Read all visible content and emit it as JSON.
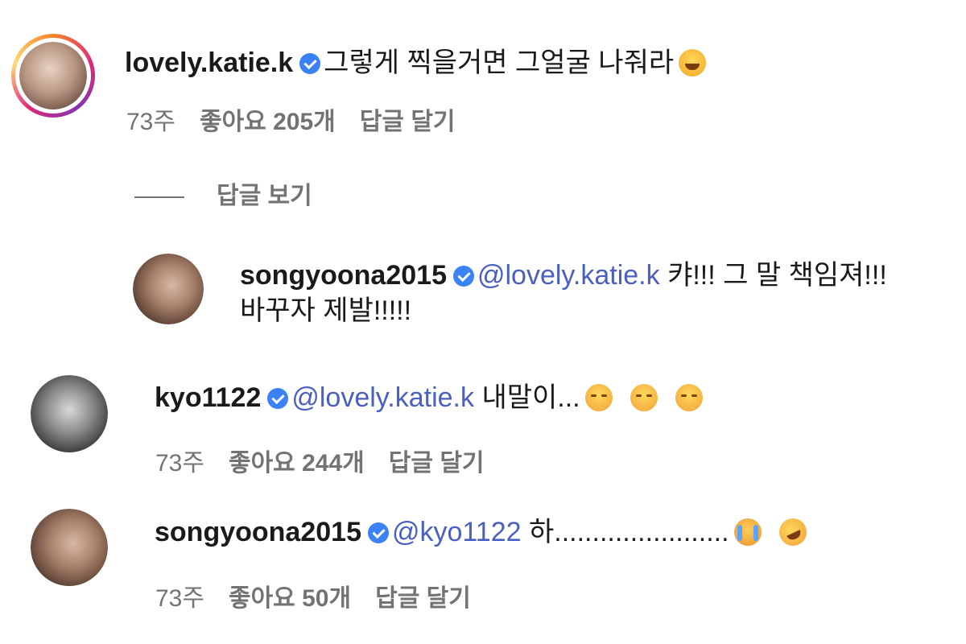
{
  "comments": [
    {
      "username": "lovely.katie.k",
      "text": "그렇게 찍을거면 그얼굴 나줘라",
      "emoji": "laughing-with-tears",
      "time": "73주",
      "likes": "좋아요 205개",
      "reply": "답글 달기",
      "avatar_story_ring": true
    },
    {
      "username": "songyoona2015",
      "mention": "@lovely.katie.k",
      "text_line1": "캬!!! 그 말 책임져!!!",
      "text_line2": "바꾸자 제발!!!!!"
    },
    {
      "username": "kyo1122",
      "mention": "@lovely.katie.k",
      "text": "내말이...",
      "emojis": [
        "pensive-face",
        "pensive-face",
        "pensive-face"
      ],
      "time": "73주",
      "likes": "좋아요 244개",
      "reply": "답글 달기"
    },
    {
      "username": "songyoona2015",
      "mention": "@kyo1122",
      "text": "하.......................",
      "emojis": [
        "crying-face",
        "rofl-face"
      ],
      "time": "73주",
      "likes": "좋아요 50개",
      "reply": "답글 달기"
    }
  ],
  "view_replies": "답글 보기",
  "colors": {
    "mention": "#4a5fc1",
    "verified": "#3b82f6",
    "meta": "#737373"
  }
}
